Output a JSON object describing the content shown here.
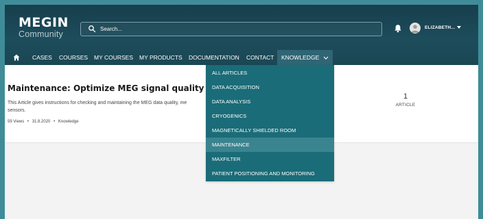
{
  "logo": {
    "top": "MEGIN",
    "bottom": "Community"
  },
  "search": {
    "placeholder": "Search..."
  },
  "user": {
    "name": "ELIZABETH..."
  },
  "nav": {
    "items": [
      "CASES",
      "COURSES",
      "MY COURSES",
      "MY PRODUCTS",
      "DOCUMENTATION",
      "CONTACT",
      "KNOWLEDGE"
    ]
  },
  "dropdown": {
    "items": [
      "ALL ARTICLES",
      "DATA ACQUISITION",
      "DATA ANALYSIS",
      "CRYOGENICS",
      "MAGNETICALLY SHIELDED ROOM",
      "MAINTENANCE",
      "MAXFILTER",
      "PATIENT POSITIONING AND MONITORING"
    ],
    "hovered_index": 5
  },
  "article": {
    "title": "Maintenance: Optimize MEG signal quality",
    "description_line1": "This Article gives instructions for checking and maintaining the MEG data quality, me",
    "description_line2": "sensors.",
    "views": "59 Views",
    "date": "31.8.2020",
    "category": "Knowledge",
    "meta_separator": "•"
  },
  "stats": {
    "count": "1",
    "label": "ARTICLE"
  },
  "colors": {
    "frame": "#3f8c98",
    "header": "#1b4754",
    "dropdown": "#1a6c78",
    "dropdown_hover": "#3a8490"
  }
}
